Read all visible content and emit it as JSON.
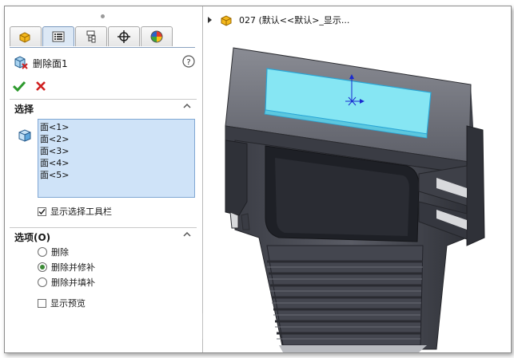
{
  "feature": {
    "title": "删除面1"
  },
  "actions": {
    "ok_icon": "checkmark-icon",
    "cancel_icon": "x-icon"
  },
  "selection": {
    "header": "选择",
    "faces": [
      "面<1>",
      "面<2>",
      "面<3>",
      "面<4>",
      "面<5>"
    ],
    "show_toolbar": {
      "label": "显示选择工具栏",
      "checked": true
    }
  },
  "options": {
    "header": "选项(O)",
    "radios": [
      {
        "label": "删除",
        "selected": false
      },
      {
        "label": "删除并修补",
        "selected": true
      },
      {
        "label": "删除并填补",
        "selected": false
      }
    ],
    "preview": {
      "label": "显示预览",
      "checked": false
    }
  },
  "tree": {
    "label": "027 (默认<<默认>_显示..."
  },
  "colors": {
    "accent_blue": "#7fa7d3",
    "ok_green": "#2e9a2e",
    "cancel_red": "#d02020",
    "face_highlight": "#86e6f3"
  }
}
